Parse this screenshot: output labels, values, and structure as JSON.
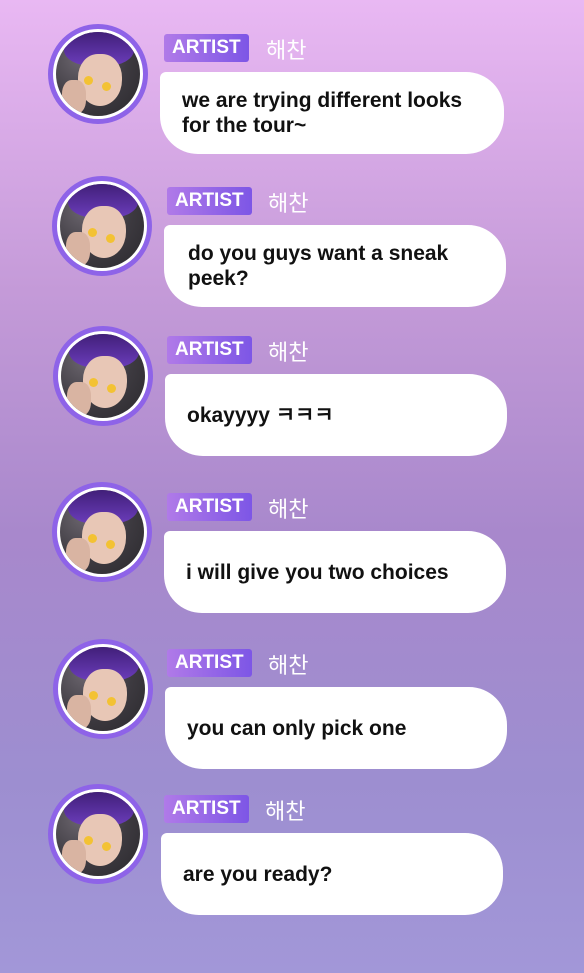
{
  "role_label": "ARTIST",
  "sender_name": "해찬",
  "messages": [
    {
      "text": "we are trying different looks for the tour~"
    },
    {
      "text": "do you guys want a sneak peek?"
    },
    {
      "text": "okayyyy ㅋㅋㅋ"
    },
    {
      "text": "i will give you two choices"
    },
    {
      "text": "you can only pick one"
    },
    {
      "text": "are you ready?"
    }
  ],
  "colors": {
    "background_top": "#e9b8f3",
    "background_bottom": "#a297d8",
    "avatar_ring": "#8e63e8",
    "tag_gradient_start": "#b07ae8",
    "tag_gradient_end": "#7d56e6",
    "bubble": "#ffffff"
  }
}
